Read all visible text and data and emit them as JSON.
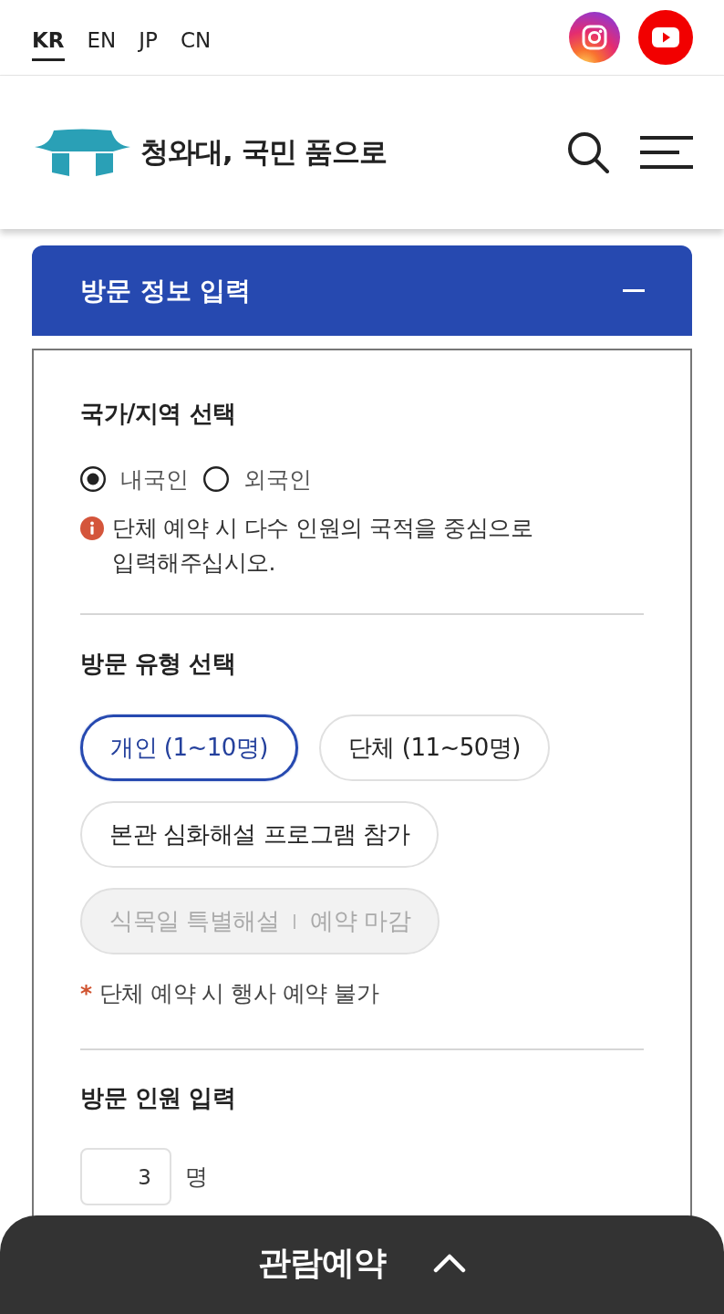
{
  "language_tabs": [
    {
      "label": "KR",
      "selected": true
    },
    {
      "label": "EN",
      "selected": false
    },
    {
      "label": "JP",
      "selected": false
    },
    {
      "label": "CN",
      "selected": false
    }
  ],
  "header": {
    "title": "청와대, 국민 품으로"
  },
  "section": {
    "title": "방문 정보 입력",
    "expanded": true
  },
  "country": {
    "title": "국가/지역 선택",
    "options": [
      {
        "label": "내국인",
        "selected": true
      },
      {
        "label": "외국인",
        "selected": false
      }
    ],
    "note": "단체 예약 시 다수 인원의 국적을 중심으로 입력해주십시오."
  },
  "visit_type": {
    "title": "방문 유형 선택",
    "options": [
      {
        "label": "개인 (1~10명)",
        "selected": true,
        "disabled": false
      },
      {
        "label": "단체 (11~50명)",
        "selected": false,
        "disabled": false
      },
      {
        "label": "본관 심화해설 프로그램 참가",
        "selected": false,
        "disabled": false
      },
      {
        "label": "식목일 특별해설",
        "status": "예약 마감",
        "selected": false,
        "disabled": true
      }
    ],
    "footnote": {
      "marker": "*",
      "text": "단체 예약 시 행사 예약 불가"
    }
  },
  "headcount": {
    "title": "방문 인원 입력",
    "value": "3",
    "unit": "명"
  },
  "booking_bar": {
    "label": "관람예약",
    "expanded": false
  }
}
